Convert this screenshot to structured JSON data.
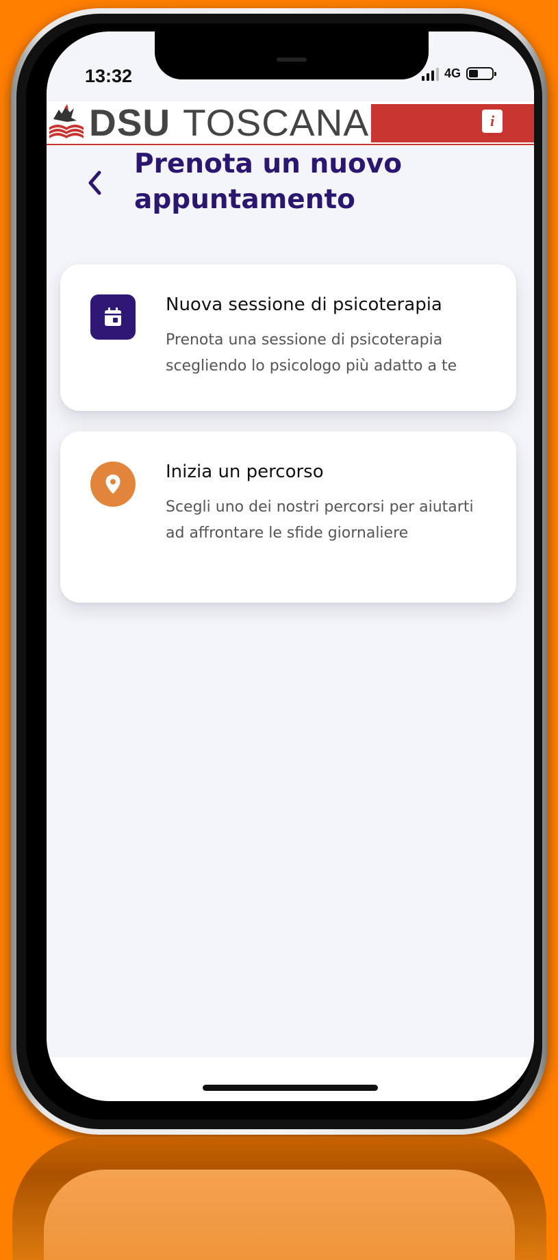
{
  "status_bar": {
    "time": "13:32",
    "network": "4G"
  },
  "header": {
    "brand_bold": "DSU",
    "brand_light": "TOSCANA",
    "info_label": "i",
    "accent_color": "#c8342f"
  },
  "page": {
    "title": "Prenota un nuovo appuntamento",
    "back_icon": "chevron-left-icon",
    "title_color": "#2b1670"
  },
  "options": [
    {
      "title": "Nuova sessione di psicoterapia",
      "description": "Prenota una sessione di psicoterapia scegliendo lo psicologo più adatto a te",
      "icon": "calendar-icon",
      "icon_color": "#2e1874"
    },
    {
      "title": "Inizia un percorso",
      "description": "Scegli uno dei nostri percorsi per aiutarti ad affrontare le sfide giornaliere",
      "icon": "location-pin-icon",
      "icon_color": "#e0853b"
    }
  ]
}
